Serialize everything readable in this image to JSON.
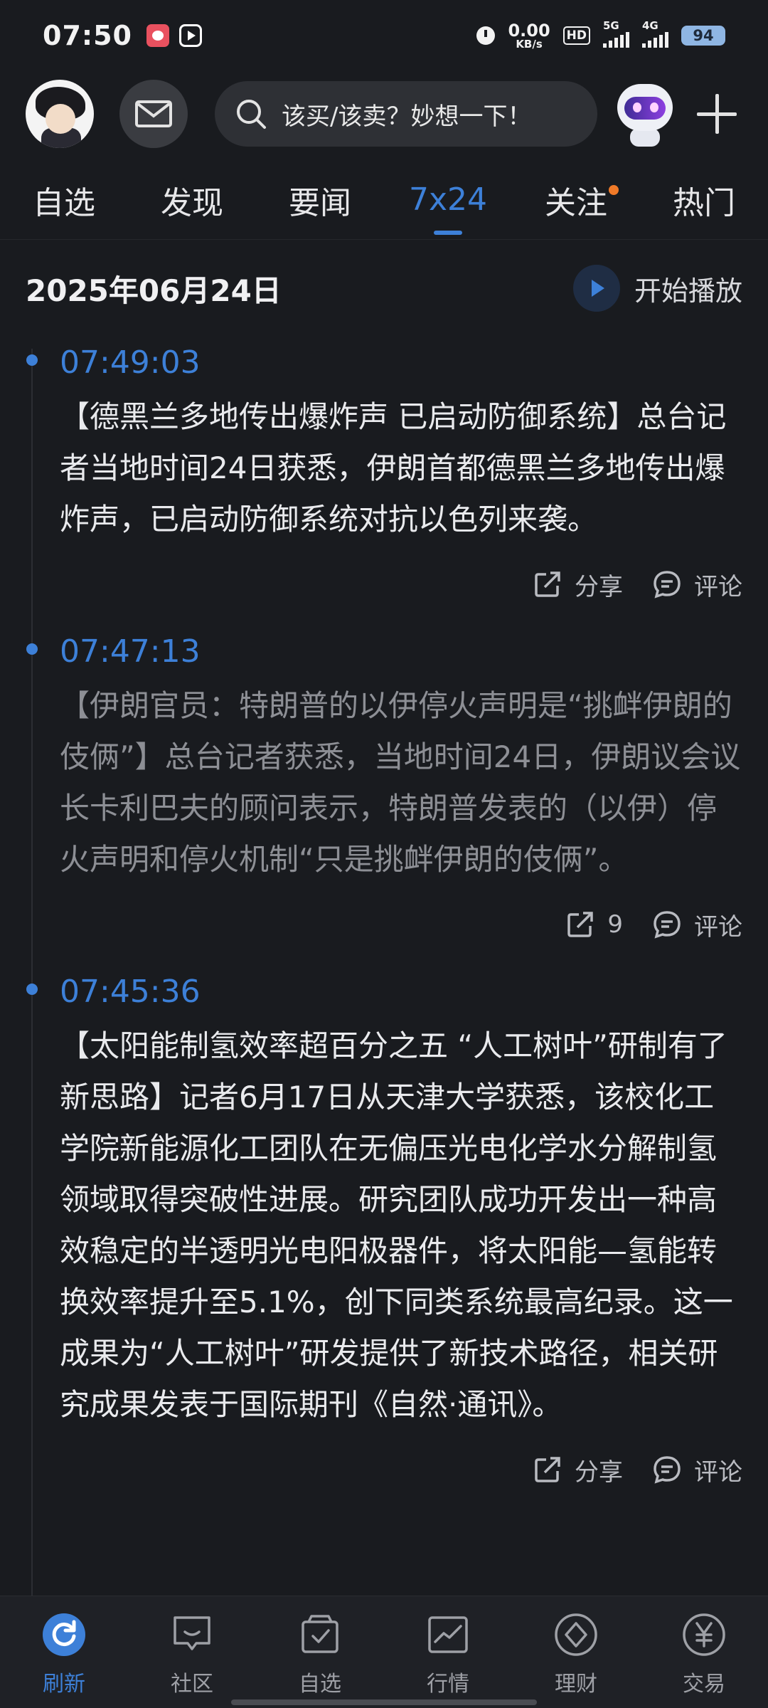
{
  "status_bar": {
    "time": "07:50",
    "net_speed_value": "0.00",
    "net_speed_unit": "KB/s",
    "hd": "HD",
    "signal1_label": "5G",
    "signal2_label": "4G",
    "battery": "94"
  },
  "header": {
    "search_placeholder": "该买/该卖？妙想一下！"
  },
  "tabs": [
    {
      "label": "自选",
      "active": false
    },
    {
      "label": "发现",
      "active": false
    },
    {
      "label": "要闻",
      "active": false
    },
    {
      "label": "7x24",
      "active": true
    },
    {
      "label": "关注",
      "active": false,
      "dot": true
    },
    {
      "label": "热门",
      "active": false
    }
  ],
  "date_row": {
    "date": "2025年06月24日",
    "play_label": "开始播放"
  },
  "news": [
    {
      "time": "07:49:03",
      "body": "【德黑兰多地传出爆炸声 已启动防御系统】总台记者当地时间24日获悉，伊朗首都德黑兰多地传出爆炸声，已启动防御系统对抗以色列来袭。",
      "share_label": "分享",
      "comment_label": "评论",
      "read": false
    },
    {
      "time": "07:47:13",
      "body": "【伊朗官员：特朗普的以伊停火声明是“挑衅伊朗的伎俩”】总台记者获悉，当地时间24日，伊朗议会议长卡利巴夫的顾问表示，特朗普发表的（以伊）停火声明和停火机制“只是挑衅伊朗的伎俩”。",
      "share_label": "9",
      "comment_label": "评论",
      "read": true
    },
    {
      "time": "07:45:36",
      "body": "【太阳能制氢效率超百分之五 “人工树叶”研制有了新思路】记者6月17日从天津大学获悉，该校化工学院新能源化工团队在无偏压光电化学水分解制氢领域取得突破性进展。研究团队成功开发出一种高效稳定的半透明光电阳极器件，将太阳能—氢能转换效率提升至5.1%，创下同类系统最高纪录。这一成果为“人工树叶”研发提供了新技术路径，相关研究成果发表于国际期刊《自然·通讯》。",
      "share_label": "分享",
      "comment_label": "评论",
      "read": false
    }
  ],
  "bottom_nav": [
    {
      "label": "刷新",
      "icon": "refresh-icon",
      "active": true
    },
    {
      "label": "社区",
      "icon": "community-icon",
      "active": false
    },
    {
      "label": "自选",
      "icon": "watchlist-icon",
      "active": false
    },
    {
      "label": "行情",
      "icon": "market-icon",
      "active": false
    },
    {
      "label": "理财",
      "icon": "wealth-icon",
      "active": false
    },
    {
      "label": "交易",
      "icon": "trade-icon",
      "active": false
    }
  ],
  "colors": {
    "accent": "#3d80d8",
    "background": "#191b1f",
    "notify_dot": "#f07a28"
  }
}
